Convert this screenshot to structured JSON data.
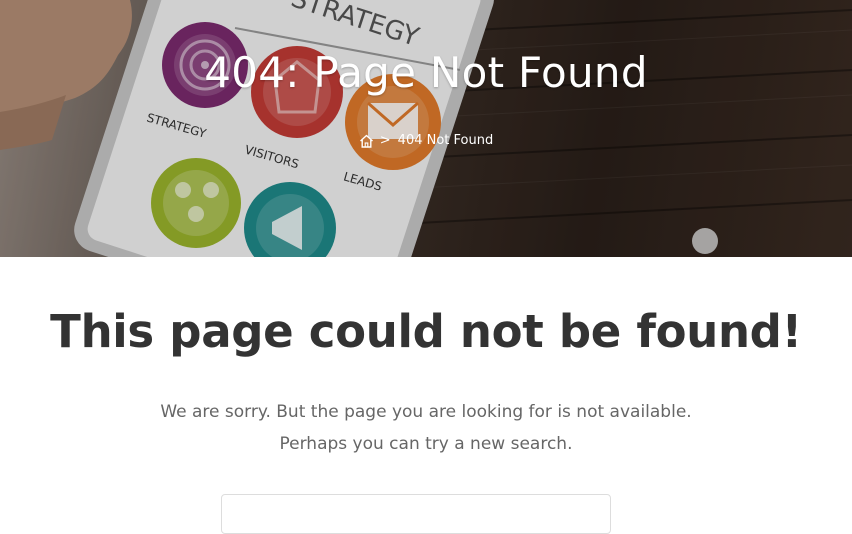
{
  "hero": {
    "title": "404: Page Not Found",
    "breadcrumb": {
      "home_icon": "home-icon",
      "separator": ">",
      "current": "404 Not Found"
    },
    "photo_labels": {
      "header": "STRATEGY",
      "strategy": "STRATEGY",
      "visitors": "VISITORS",
      "leads": "LEADS"
    }
  },
  "content": {
    "heading": "This page could not be found!",
    "message_line1": "We are sorry. But the page you are looking for is not available.",
    "message_line2": "Perhaps you can try a new search."
  },
  "colors": {
    "heading": "#333333",
    "message": "#666666",
    "hero_text": "#ffffff",
    "icon_purple": "#7b2a6e",
    "icon_red": "#c23b35",
    "icon_orange": "#e07a2a",
    "icon_green": "#9ab42c",
    "icon_teal": "#1f8a8a"
  }
}
